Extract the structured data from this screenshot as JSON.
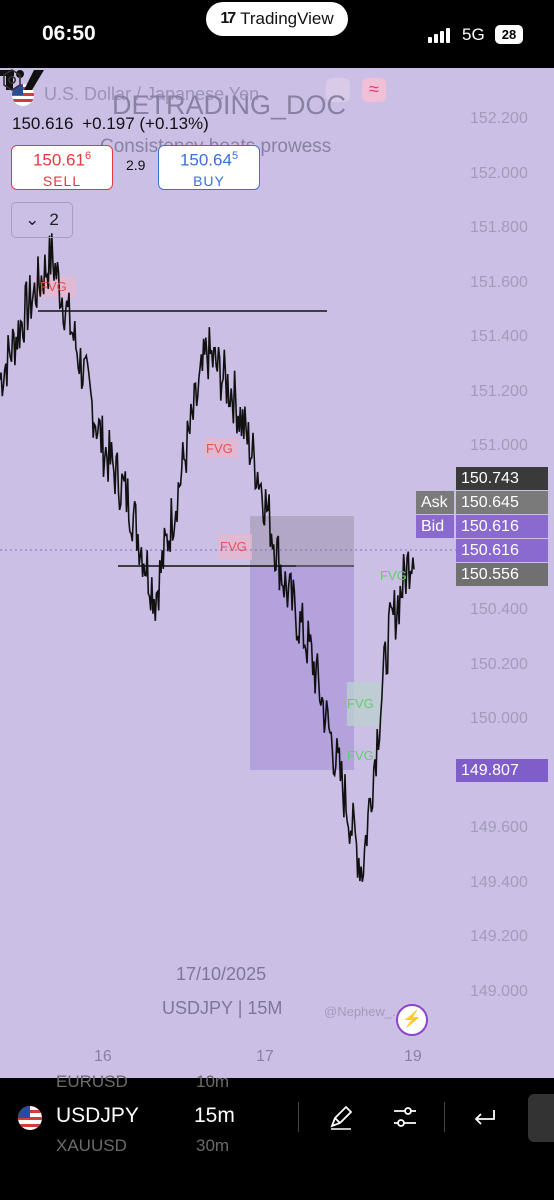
{
  "status_bar": {
    "time": "06:50",
    "app_pill": "TradingView",
    "network": "5G",
    "battery": "28"
  },
  "chart_header": {
    "symbol_name": "U.S. Dollar / Japanese Yen",
    "watermark_title": "DETRADING_DOC",
    "watermark_subtitle": "Consistency beats prowess",
    "last_price": "150.616",
    "change": "+0.197 (+0.13%)",
    "sell": {
      "price_main": "150.61",
      "price_sup": "6",
      "label": "SELL"
    },
    "buy": {
      "price_main": "150.64",
      "price_sup": "5",
      "label": "BUY"
    },
    "spread": "2.9",
    "collapse_count": "2"
  },
  "price_axis": [
    "152.200",
    "152.000",
    "151.800",
    "151.600",
    "151.400",
    "151.200",
    "151.000",
    "150.400",
    "150.200",
    "150.000",
    "149.600",
    "149.400",
    "149.200",
    "149.000"
  ],
  "price_tags": {
    "high": "150.743",
    "ask_label": "Ask",
    "ask": "150.645",
    "bid_label": "Bid",
    "bid": "150.616",
    "last": "150.616",
    "low": "150.556",
    "box_low": "149.807"
  },
  "fvg_label": "FVG",
  "time_axis": [
    "16",
    "17",
    "19"
  ],
  "footer": {
    "date": "17/10/2025",
    "symbol_timeframe": "USDJPY | 15M",
    "credit": "@Nephew_..._"
  },
  "colors": {
    "background": "#ccbfe6",
    "sell": "#e0393f",
    "buy": "#3d6fd6",
    "bearish_fvg": "#e85050",
    "bullish_fvg": "#5fcf6a",
    "tag_purple": "#8b6ad0",
    "tag_dark": "#3a3a3a"
  },
  "bottom_toolbar": {
    "prev_symbol": "EURUSD",
    "prev_tf": "10m",
    "symbol": "USDJPY",
    "timeframe": "15m",
    "next_symbol": "XAUUSD",
    "next_tf": "30m",
    "icons": [
      "draw-pencil-icon",
      "indicators-sliders-icon",
      "undo-arrow-icon",
      "more-icon"
    ]
  },
  "chart_data": {
    "type": "line",
    "title": "U.S. Dollar / Japanese Yen",
    "xlabel": "",
    "ylabel": "",
    "ylim": [
      149.0,
      152.2
    ],
    "x": [
      "16",
      "",
      "",
      "",
      "",
      "",
      "",
      "",
      "17",
      "",
      "",
      "",
      "",
      "",
      "",
      "",
      "19"
    ],
    "series": [
      {
        "values": [
          151.25,
          151.5,
          151.7,
          151.35,
          151.0,
          150.8,
          150.45,
          150.9,
          151.35,
          151.2,
          150.9,
          150.5,
          150.25,
          149.85,
          149.45,
          150.3,
          150.65
        ]
      }
    ],
    "horizontal_levels": [
      151.52,
      150.55
    ],
    "annotations": [
      "FVG",
      "FVG",
      "FVG",
      "FVG",
      "FVG",
      "FVG"
    ],
    "grid": false
  }
}
